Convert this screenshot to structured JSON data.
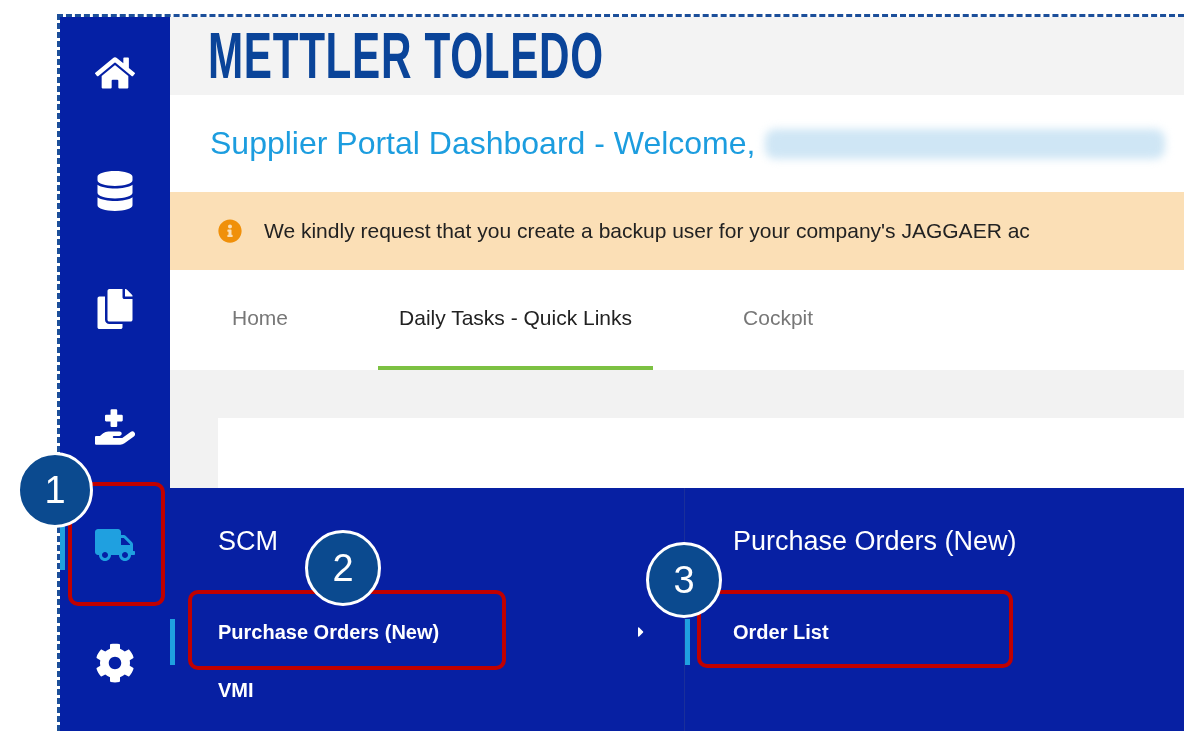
{
  "sidebar": {
    "items": [
      {
        "kind": "home",
        "selected": false
      },
      {
        "kind": "database",
        "selected": false
      },
      {
        "kind": "documents",
        "selected": false
      },
      {
        "kind": "help",
        "selected": false
      },
      {
        "kind": "truck",
        "selected": true
      },
      {
        "kind": "settings",
        "selected": false
      }
    ]
  },
  "header": {
    "logo": "METTLER TOLEDO",
    "title": "Supplier Portal Dashboard - Welcome,"
  },
  "notice": {
    "text": "We kindly request that you create a backup user for your company's JAGGAER ac"
  },
  "tabs": [
    {
      "label": "Home",
      "selected": false
    },
    {
      "label": "Daily Tasks - Quick Links",
      "selected": true
    },
    {
      "label": "Cockpit",
      "selected": false
    }
  ],
  "flyout": {
    "columns": [
      {
        "heading": "SCM",
        "items": [
          {
            "label": "Purchase Orders (New)",
            "selected": true,
            "has_submenu": true
          },
          {
            "label": "VMI",
            "selected": false,
            "has_submenu": false
          }
        ]
      },
      {
        "heading": "Purchase Orders (New)",
        "items": [
          {
            "label": "Order List",
            "selected": true,
            "has_submenu": false
          }
        ]
      }
    ]
  },
  "annotations": [
    {
      "number": "1"
    },
    {
      "number": "2"
    },
    {
      "number": "3"
    }
  ]
}
